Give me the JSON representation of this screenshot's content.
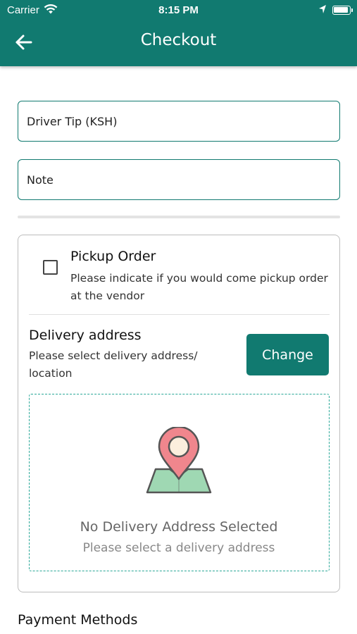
{
  "status_bar": {
    "carrier": "Carrier",
    "time": "8:15 PM"
  },
  "header": {
    "title": "Checkout",
    "back_icon": "arrow-left-icon",
    "background": "#117a70"
  },
  "form": {
    "driver_tip_placeholder": "Driver Tip (KSH)",
    "note_placeholder": "Note"
  },
  "pickup": {
    "checked": false,
    "title": "Pickup Order",
    "description": "Please indicate if you would come pickup order at the vendor"
  },
  "delivery": {
    "title": "Delivery address",
    "description": "Please select delivery address/ location",
    "change_label": "Change",
    "empty_icon": "map-pin-icon",
    "empty_title": "No Delivery Address Selected",
    "empty_subtitle": "Please select a delivery address"
  },
  "payment": {
    "title": "Payment Methods"
  },
  "colors": {
    "accent": "#117a70",
    "dashed_border": "#2aa898",
    "pin": "#f0868d",
    "map": "#9fd8b3"
  }
}
